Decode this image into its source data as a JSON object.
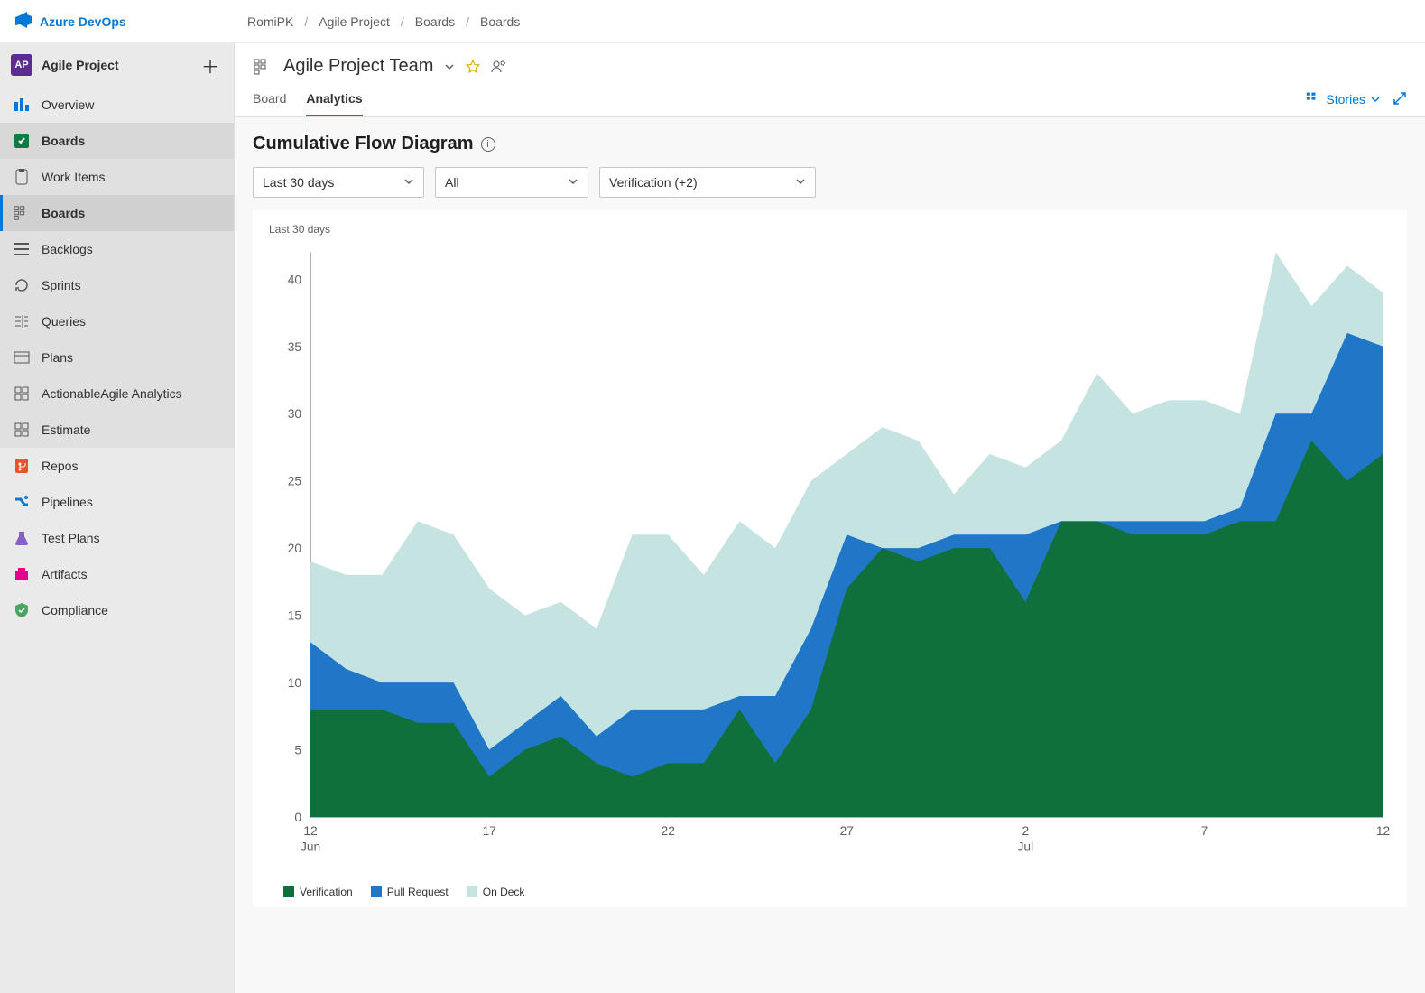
{
  "brand": "Azure DevOps",
  "breadcrumb": [
    "RomiPK",
    "Agile Project",
    "Boards",
    "Boards"
  ],
  "project": {
    "badge": "AP",
    "name": "Agile Project"
  },
  "sidebar": {
    "primary": [
      {
        "label": "Overview",
        "icon": "overview"
      },
      {
        "label": "Boards",
        "icon": "boards",
        "expanded": true,
        "children": [
          {
            "label": "Work Items",
            "icon": "workitems"
          },
          {
            "label": "Boards",
            "icon": "boards2",
            "active": true
          },
          {
            "label": "Backlogs",
            "icon": "backlogs"
          },
          {
            "label": "Sprints",
            "icon": "sprints"
          },
          {
            "label": "Queries",
            "icon": "queries"
          },
          {
            "label": "Plans",
            "icon": "plans"
          },
          {
            "label": "ActionableAgile Analytics",
            "icon": "grid"
          },
          {
            "label": "Estimate",
            "icon": "grid"
          }
        ]
      },
      {
        "label": "Repos",
        "icon": "repos"
      },
      {
        "label": "Pipelines",
        "icon": "pipelines"
      },
      {
        "label": "Test Plans",
        "icon": "testplans"
      },
      {
        "label": "Artifacts",
        "icon": "artifacts"
      },
      {
        "label": "Compliance",
        "icon": "compliance"
      }
    ]
  },
  "team": {
    "name": "Agile Project Team"
  },
  "tabs": [
    {
      "label": "Board",
      "active": false
    },
    {
      "label": "Analytics",
      "active": true
    }
  ],
  "right_control": {
    "label": "Stories"
  },
  "section": {
    "title": "Cumulative Flow Diagram"
  },
  "filters": {
    "time": "Last 30 days",
    "swimlanes": "All",
    "columns": "Verification (+2)"
  },
  "chart_caption": "Last 30 days",
  "legend": [
    {
      "label": "Verification",
      "color": "#0f703b"
    },
    {
      "label": "Pull Request",
      "color": "#2177c7"
    },
    {
      "label": "On Deck",
      "color": "#c5e3e1"
    }
  ],
  "chart_data": {
    "type": "area",
    "title": "Cumulative Flow Diagram",
    "ylabel": "",
    "xlabel": "",
    "ylim": [
      0,
      42
    ],
    "y_ticks": [
      0,
      5,
      10,
      15,
      20,
      25,
      30,
      35,
      40
    ],
    "x_tick_labels": [
      "12 Jun",
      "17",
      "22",
      "27",
      "2 Jul",
      "7",
      "12"
    ],
    "x": [
      12,
      13,
      14,
      15,
      16,
      17,
      18,
      19,
      20,
      21,
      22,
      23,
      24,
      25,
      26,
      27,
      28,
      29,
      30,
      1,
      2,
      3,
      4,
      5,
      6,
      7,
      8,
      9,
      10,
      11,
      12
    ],
    "series": [
      {
        "name": "Verification",
        "color": "#0f703b",
        "values": [
          8,
          8,
          8,
          7,
          7,
          3,
          5,
          6,
          4,
          3,
          4,
          4,
          8,
          4,
          8,
          17,
          20,
          19,
          20,
          20,
          16,
          22,
          22,
          21,
          21,
          21,
          22,
          22,
          28,
          25,
          27
        ]
      },
      {
        "name": "Pull Request",
        "color": "#2177c7",
        "values": [
          13,
          11,
          10,
          10,
          10,
          5,
          7,
          9,
          6,
          8,
          8,
          8,
          9,
          9,
          14,
          21,
          20,
          20,
          21,
          21,
          21,
          22,
          22,
          22,
          22,
          22,
          23,
          30,
          30,
          36,
          35
        ]
      },
      {
        "name": "On Deck",
        "color": "#c5e3e1",
        "values": [
          19,
          18,
          18,
          22,
          21,
          17,
          15,
          16,
          14,
          21,
          21,
          18,
          22,
          20,
          25,
          27,
          29,
          28,
          24,
          27,
          26,
          28,
          33,
          30,
          31,
          31,
          30,
          42,
          38,
          41,
          39
        ]
      }
    ]
  }
}
